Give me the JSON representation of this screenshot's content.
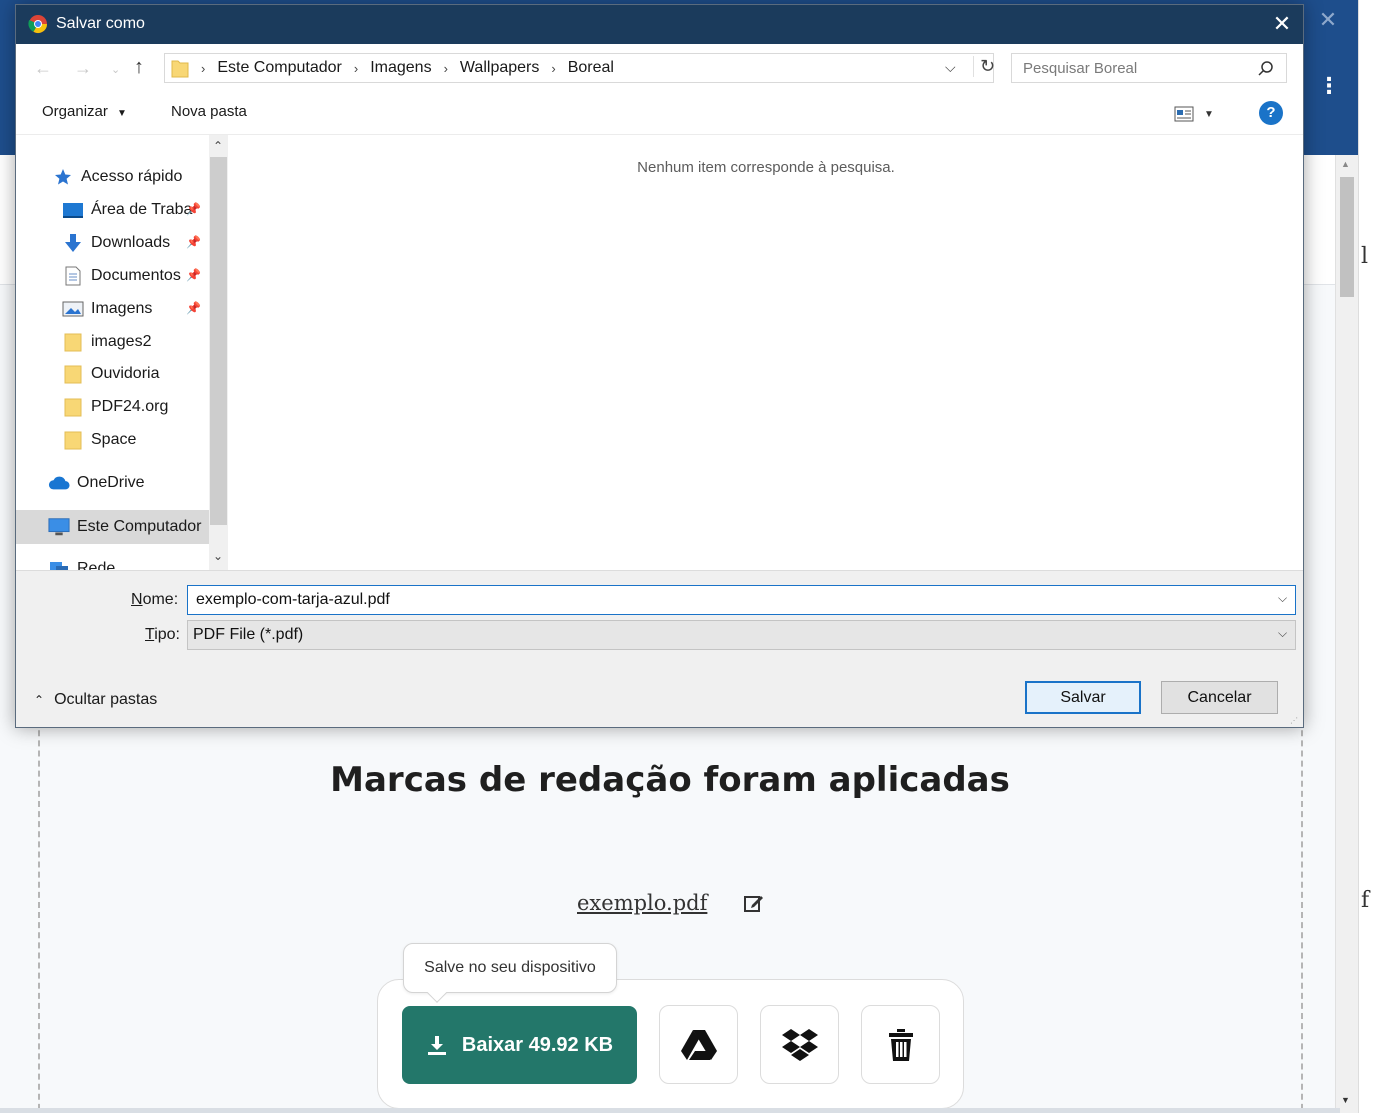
{
  "dialog": {
    "title": "Salvar como",
    "breadcrumbs": [
      "Este Computador",
      "Imagens",
      "Wallpapers",
      "Boreal"
    ],
    "search_placeholder": "Pesquisar Boreal",
    "toolbar": {
      "organize_label": "Organizar",
      "new_folder_label": "Nova pasta",
      "help_label": "?"
    },
    "nav_tree": [
      {
        "label": "Acesso rápido",
        "icon": "star-icon",
        "pinned": false
      },
      {
        "label": "Área de Traba",
        "icon": "desktop-icon",
        "pinned": true
      },
      {
        "label": "Downloads",
        "icon": "download-arrow-icon",
        "pinned": true
      },
      {
        "label": "Documentos",
        "icon": "document-icon",
        "pinned": true
      },
      {
        "label": "Imagens",
        "icon": "pictures-icon",
        "pinned": true
      },
      {
        "label": "images2",
        "icon": "folder-icon",
        "pinned": false
      },
      {
        "label": "Ouvidoria",
        "icon": "folder-icon",
        "pinned": false
      },
      {
        "label": "PDF24.org",
        "icon": "folder-icon",
        "pinned": false
      },
      {
        "label": "Space",
        "icon": "folder-icon",
        "pinned": false
      },
      {
        "label": "OneDrive",
        "icon": "cloud-icon",
        "pinned": false
      },
      {
        "label": "Este Computador",
        "icon": "computer-icon",
        "pinned": false,
        "selected": true
      },
      {
        "label": "Rede",
        "icon": "network-icon",
        "pinned": false
      }
    ],
    "empty_message": "Nenhum item corresponde à pesquisa.",
    "name_label_key": "N",
    "name_label_rest": "ome:",
    "name_value": "exemplo-com-tarja-azul.pdf",
    "type_label_key": "T",
    "type_label_rest": "ipo:",
    "type_value": "PDF File (*.pdf)",
    "hide_folders_label": "Ocultar pastas",
    "save_label": "Salvar",
    "cancel_label": "Cancelar"
  },
  "page": {
    "heading": "Marcas de redação foram aplicadas",
    "filename": "exemplo.pdf",
    "tooltip": "Salve no seu dispositivo",
    "download_label": "Baixar 49.92 KB",
    "action_icons": [
      "google-drive-icon",
      "dropbox-icon",
      "trash-icon"
    ],
    "accent_color": "#23776a",
    "header_color": "#1e4e8c"
  }
}
